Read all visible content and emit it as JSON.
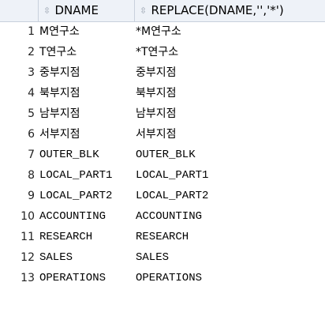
{
  "columns": [
    {
      "label": ""
    },
    {
      "label": "DNAME"
    },
    {
      "label": "REPLACE(DNAME,'','*')"
    }
  ],
  "rows": [
    {
      "num": "1",
      "dname": " M연구소",
      "replaced": "*M연구소"
    },
    {
      "num": "2",
      "dname": " T연구소",
      "replaced": "*T연구소"
    },
    {
      "num": "3",
      "dname": "중부지점",
      "replaced": "중부지점"
    },
    {
      "num": "4",
      "dname": "북부지점",
      "replaced": "북부지점"
    },
    {
      "num": "5",
      "dname": "남부지점",
      "replaced": "남부지점"
    },
    {
      "num": "6",
      "dname": "서부지점",
      "replaced": "서부지점"
    },
    {
      "num": "7",
      "dname": "OUTER_BLK",
      "replaced": "OUTER_BLK"
    },
    {
      "num": "8",
      "dname": "LOCAL_PART1",
      "replaced": "LOCAL_PART1"
    },
    {
      "num": "9",
      "dname": "LOCAL_PART2",
      "replaced": "LOCAL_PART2"
    },
    {
      "num": "10",
      "dname": "ACCOUNTING",
      "replaced": "ACCOUNTING"
    },
    {
      "num": "11",
      "dname": "RESEARCH",
      "replaced": "RESEARCH"
    },
    {
      "num": "12",
      "dname": "SALES",
      "replaced": "SALES"
    },
    {
      "num": "13",
      "dname": "OPERATIONS",
      "replaced": "OPERATIONS"
    }
  ],
  "icons": {
    "sort": "sort-icon"
  }
}
